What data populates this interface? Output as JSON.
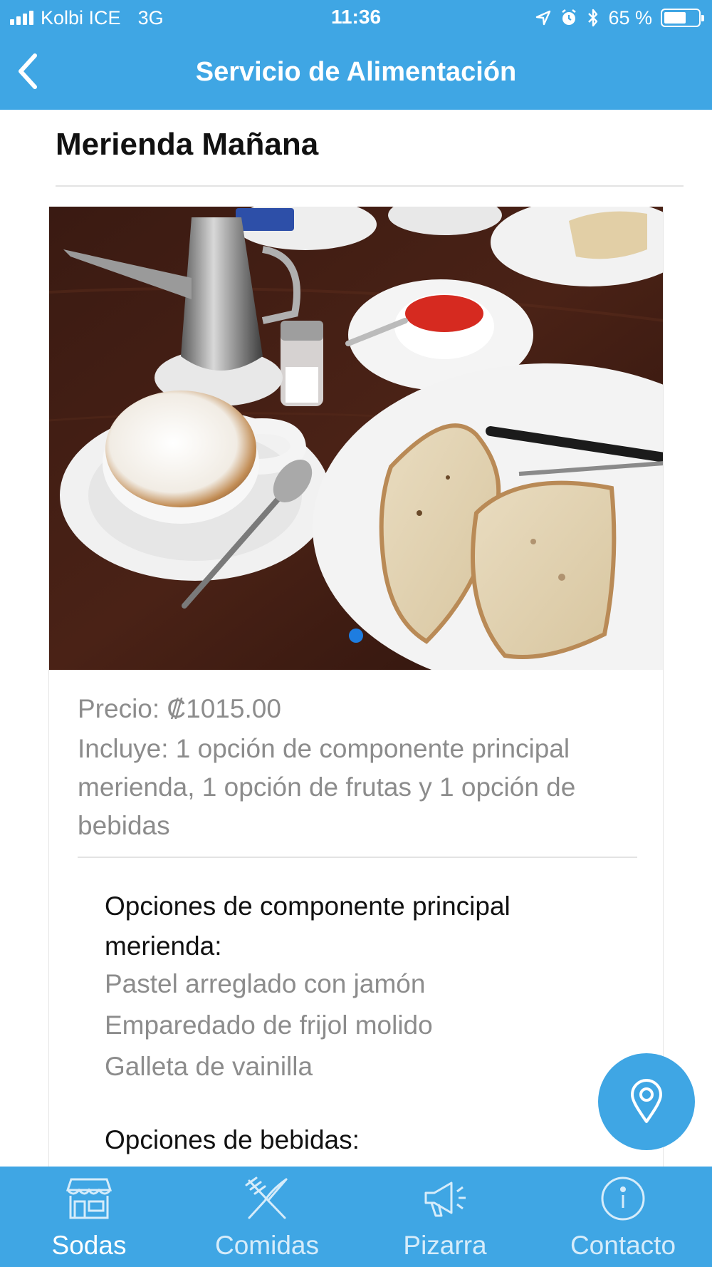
{
  "status_bar": {
    "carrier": "Kolbi ICE",
    "network": "3G",
    "time": "11:36",
    "battery_percent": "65 %",
    "battery_level": 0.65
  },
  "nav": {
    "title": "Servicio de Alimentación"
  },
  "item": {
    "title": "Merienda Mañana",
    "price": "Precio: ₡1015.00",
    "includes": "Incluye: 1 opción de componente principal merienda, 1 opción de frutas y 1 opción de bebidas",
    "carousel_page": 1,
    "carousel_total": 1
  },
  "options": {
    "main": {
      "heading": "Opciones de componente principal merienda:",
      "items": [
        "Pastel arreglado con jamón",
        "Emparedado de frijol molido",
        "Galleta de vainilla"
      ]
    },
    "drinks": {
      "heading": "Opciones de bebidas:"
    }
  },
  "tabs": [
    {
      "label": "Sodas",
      "icon": "store-icon",
      "active": true
    },
    {
      "label": "Comidas",
      "icon": "fork-knife-icon",
      "active": false
    },
    {
      "label": "Pizarra",
      "icon": "megaphone-icon",
      "active": false
    },
    {
      "label": "Contacto",
      "icon": "info-icon",
      "active": false
    }
  ],
  "colors": {
    "primary": "#3fa6e4",
    "muted_text": "#8c8c8c",
    "carousel_dot": "#1e7de0"
  }
}
